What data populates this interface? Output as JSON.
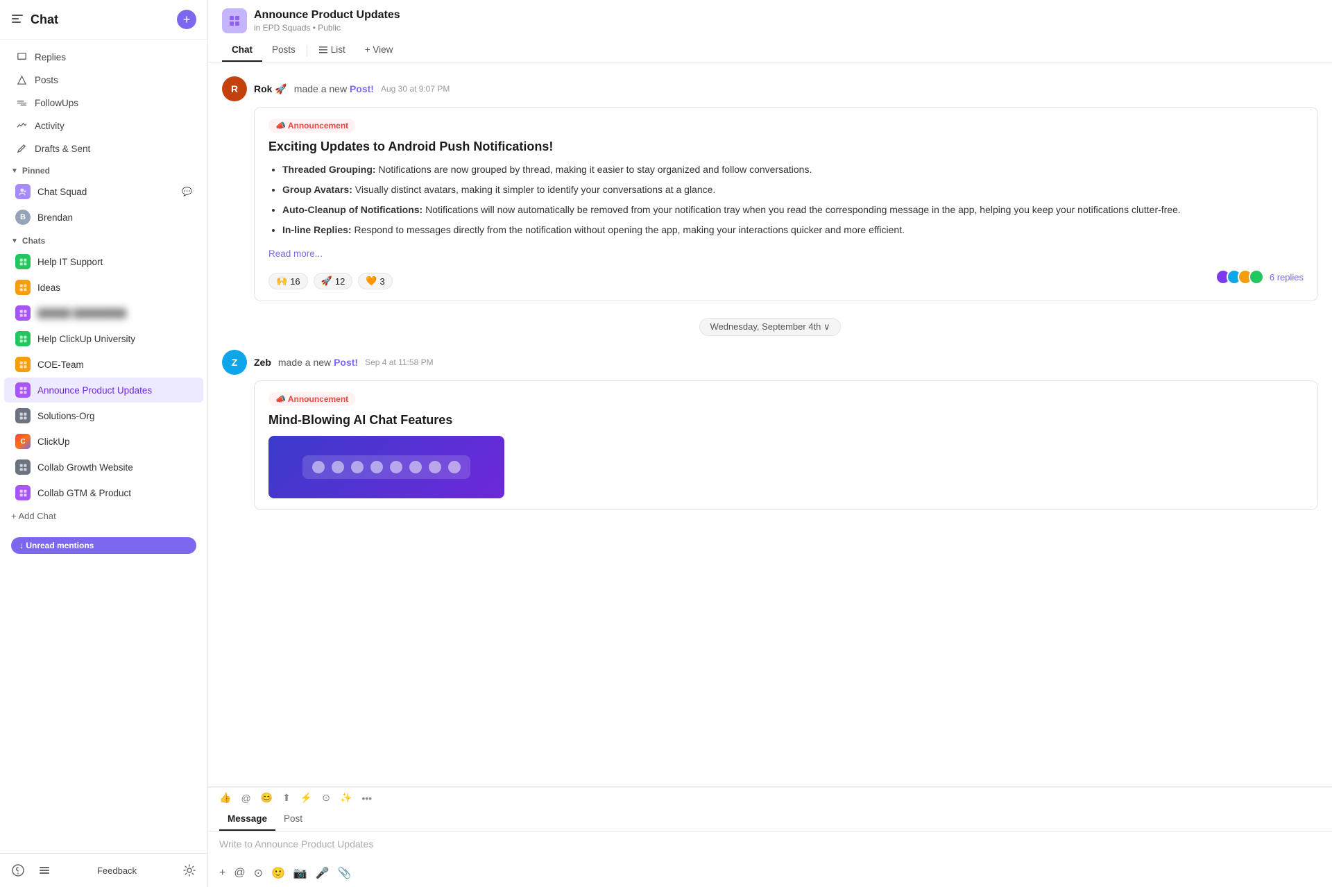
{
  "sidebar": {
    "title": "Chat",
    "add_button": "+",
    "nav_items": [
      {
        "id": "replies",
        "label": "Replies",
        "icon": "💬"
      },
      {
        "id": "posts",
        "label": "Posts",
        "icon": "△"
      },
      {
        "id": "followups",
        "label": "FollowUps",
        "icon": "⇌"
      },
      {
        "id": "activity",
        "label": "Activity",
        "icon": "∿"
      },
      {
        "id": "drafts",
        "label": "Drafts & Sent",
        "icon": "✈"
      }
    ],
    "pinned_section": "Pinned",
    "pinned_items": [
      {
        "id": "chat-squad",
        "label": "Chat Squad",
        "avatar_color": "#a78bfa",
        "has_bubble": true
      },
      {
        "id": "brendan",
        "label": "Brendan",
        "avatar_color": "#94a3b8",
        "is_circle": true
      }
    ],
    "chats_section": "Chats",
    "chat_items": [
      {
        "id": "help-it",
        "label": "Help IT Support",
        "avatar_color": "#22c55e"
      },
      {
        "id": "ideas",
        "label": "Ideas",
        "avatar_color": "#f59e0b"
      },
      {
        "id": "blurred",
        "label": "█████ ████████",
        "avatar_color": "#a855f7",
        "blurred": true
      },
      {
        "id": "help-clickup",
        "label": "Help ClickUp University",
        "avatar_color": "#22c55e"
      },
      {
        "id": "coe-team",
        "label": "COE-Team",
        "avatar_color": "#f59e0b"
      },
      {
        "id": "announce",
        "label": "Announce Product Updates",
        "avatar_color": "#a855f7",
        "active": true
      },
      {
        "id": "solutions-org",
        "label": "Solutions-Org",
        "avatar_color": "#6b7280"
      },
      {
        "id": "clickup",
        "label": "ClickUp",
        "avatar_color": "#ef4444",
        "is_clickup": true
      },
      {
        "id": "collab-growth",
        "label": "Collab Growth Website",
        "avatar_color": "#6b7280"
      },
      {
        "id": "collab-gtm",
        "label": "Collab GTM & Product",
        "avatar_color": "#a855f7"
      }
    ],
    "add_chat_label": "+ Add Chat",
    "unread_label": "↓ Unread mentions",
    "footer": {
      "feedback_label": "Feedback"
    }
  },
  "channel": {
    "name": "Announce Product Updates",
    "subtitle": "in EPD Squads • Public",
    "tabs": [
      {
        "id": "chat",
        "label": "Chat",
        "active": true
      },
      {
        "id": "posts",
        "label": "Posts"
      },
      {
        "id": "list",
        "label": "List"
      },
      {
        "id": "view",
        "label": "+ View"
      }
    ]
  },
  "messages": [
    {
      "id": "msg1",
      "author": "Rok 🚀",
      "action": "made a new",
      "post_label": "Post!",
      "time": "Aug 30 at 9:07 PM",
      "avatar_color": "#c2410c",
      "avatar_initials": "R",
      "announcement_label": "📣 Announcement",
      "post_title": "Exciting Updates to Android Push Notifications!",
      "bullet_items": [
        {
          "bold": "Threaded Grouping:",
          "text": " Notifications are now grouped by thread, making it easier to stay organized and follow conversations."
        },
        {
          "bold": "Group Avatars:",
          "text": " Visually distinct avatars, making it simpler to identify your conversations at a glance."
        },
        {
          "bold": "Auto-Cleanup of Notifications:",
          "text": " Notifications will now automatically be removed from your notification tray when you read the corresponding message in the app, helping you keep your notifications clutter-free."
        },
        {
          "bold": "In-line Replies:",
          "text": " Respond to messages directly from the notification without opening the app, making your interactions quicker and more efficient."
        }
      ],
      "read_more": "Read more...",
      "reactions": [
        {
          "emoji": "🙌",
          "count": "16"
        },
        {
          "emoji": "🚀",
          "count": "12"
        },
        {
          "emoji": "🧡",
          "count": "3"
        }
      ],
      "reply_count": "6 replies",
      "reply_avatars": [
        "#7c3aed",
        "#0ea5e9",
        "#f59e0b",
        "#22c55e"
      ]
    },
    {
      "id": "msg2",
      "author": "Zeb",
      "action": "made a new",
      "post_label": "Post!",
      "time": "Sep 4 at 11:58 PM",
      "avatar_color": "#0ea5e9",
      "avatar_initials": "Z",
      "announcement_label": "📣 Announcement",
      "post_title": "Mind-Blowing AI Chat Features"
    }
  ],
  "date_separator": "Wednesday, September 4th ∨",
  "input": {
    "placeholder": "Write to Announce Product Updates",
    "tab_message": "Message",
    "tab_post": "Post"
  }
}
